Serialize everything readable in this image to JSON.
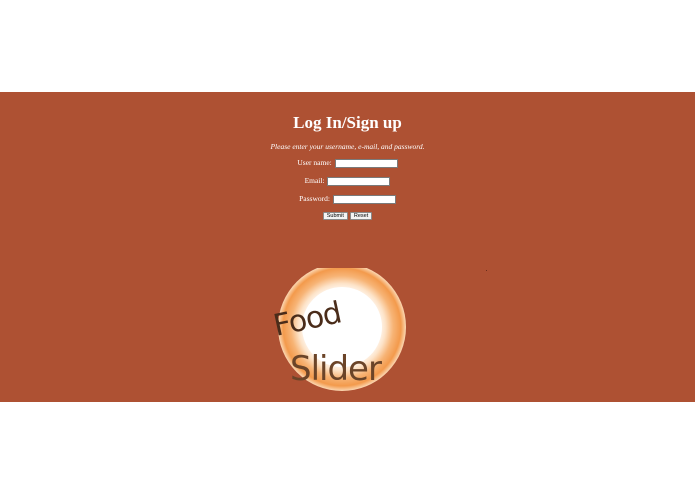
{
  "form": {
    "title": "Log In/Sign up",
    "instructions": "Please enter your username, e-mail, and password.",
    "fields": {
      "username": {
        "label": "User name:",
        "value": ""
      },
      "email": {
        "label": "Email:",
        "value": ""
      },
      "password": {
        "label": "Password:",
        "value": ""
      }
    },
    "submit_label": "Submit",
    "reset_label": "Reset"
  },
  "logo": {
    "line1": "Food",
    "line2": "Slider"
  },
  "colors": {
    "panel_background": "#ae5133",
    "page_background": "#ffffff",
    "text": "#ffffff",
    "logo_text": "#4a2c1a"
  },
  "icons": {
    "logo": "food-slider-plate-logo"
  }
}
